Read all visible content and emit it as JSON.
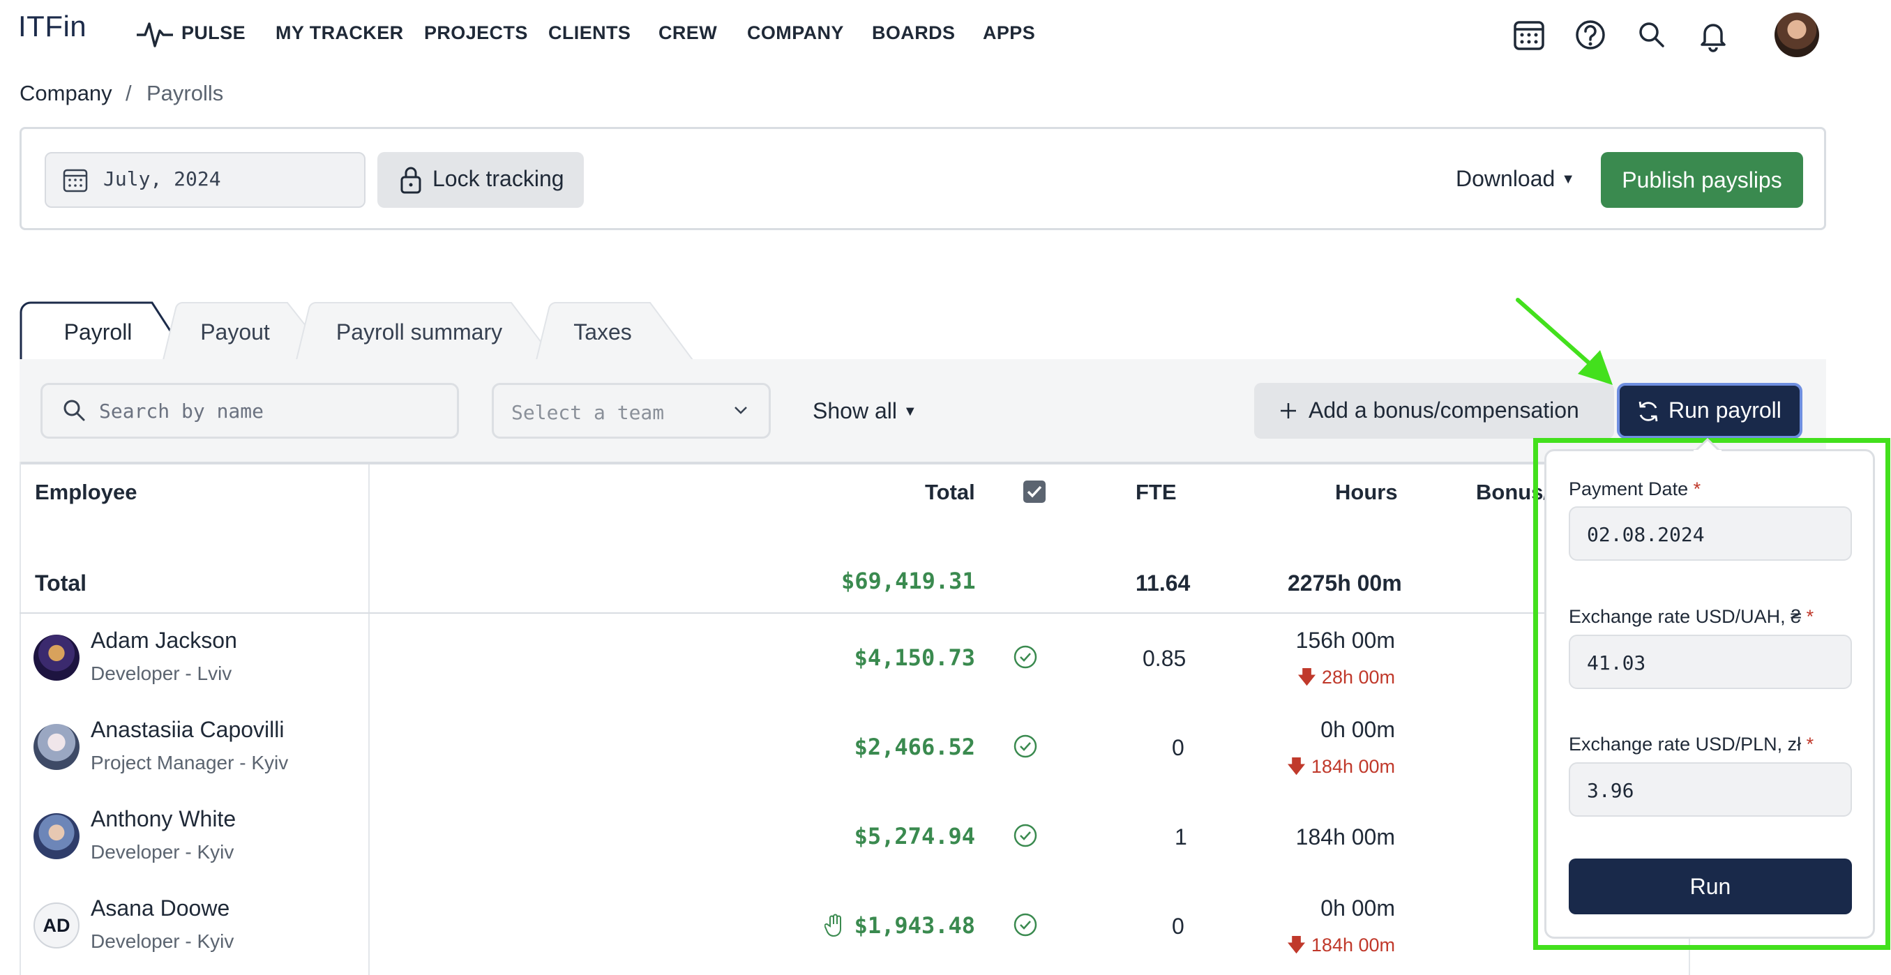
{
  "app": {
    "logo": "ITFin"
  },
  "nav": {
    "items": [
      "PULSE",
      "MY TRACKER",
      "PROJECTS",
      "CLIENTS",
      "CREW",
      "COMPANY",
      "BOARDS",
      "APPS"
    ]
  },
  "breadcrumb": {
    "parent": "Company",
    "separator": "/",
    "current": "Payrolls"
  },
  "toolbar": {
    "period": "July, 2024",
    "lock_label": "Lock tracking",
    "download_label": "Download",
    "publish_label": "Publish payslips"
  },
  "tabs": [
    "Payroll",
    "Payout",
    "Payroll summary",
    "Taxes"
  ],
  "filters": {
    "search_placeholder": "Search by name",
    "team_placeholder": "Select a team",
    "show_all_label": "Show all",
    "bonus_label": "Add a bonus/compensation",
    "run_payroll_label": "Run payroll"
  },
  "table": {
    "columns": {
      "employee": "Employee",
      "total": "Total",
      "fte": "FTE",
      "hours": "Hours",
      "bonus": "Bonus/"
    },
    "total_row": {
      "label": "Total",
      "total": "$69,419.31",
      "fte": "11.64",
      "hours": "2275h 00m"
    },
    "rows": [
      {
        "name": "Adam Jackson",
        "role": "Developer - Lviv",
        "total": "$4,150.73",
        "fte": "0.85",
        "hours": "156h 00m",
        "deficit": "28h 00m"
      },
      {
        "name": "Anastasiia Capovilli",
        "role": "Project Manager - Kyiv",
        "total": "$2,466.52",
        "fte": "0",
        "hours": "0h 00m",
        "deficit": "184h 00m"
      },
      {
        "name": "Anthony White",
        "role": "Developer - Kyiv",
        "total": "$5,274.94",
        "fte": "1",
        "hours": "184h 00m",
        "deficit": ""
      },
      {
        "name": "Asana Doowe",
        "role": "Developer - Kyiv",
        "initials": "AD",
        "total": "$1,943.48",
        "fte": "0",
        "hours": "0h 00m",
        "deficit": "184h 00m"
      }
    ]
  },
  "run_popover": {
    "payment_date_label": "Payment Date",
    "payment_date": "02.08.2024",
    "uah_label": "Exchange rate USD/UAH, ₴",
    "uah_rate": "41.03",
    "pln_label": "Exchange rate USD/PLN, zł",
    "pln_rate": "3.96",
    "required_mark": "*",
    "run_label": "Run"
  },
  "colors": {
    "accent_green": "#3a8a4f",
    "navy": "#19294a",
    "highlight": "#43e01d",
    "deficit_red": "#c0392b"
  },
  "icons": [
    "pulse-icon",
    "calendar-grid-icon",
    "help-icon",
    "search-icon",
    "bell-icon",
    "lock-icon",
    "refresh-icon",
    "plus-icon",
    "check-circle-icon",
    "hand-icon",
    "arrow-down-icon"
  ]
}
